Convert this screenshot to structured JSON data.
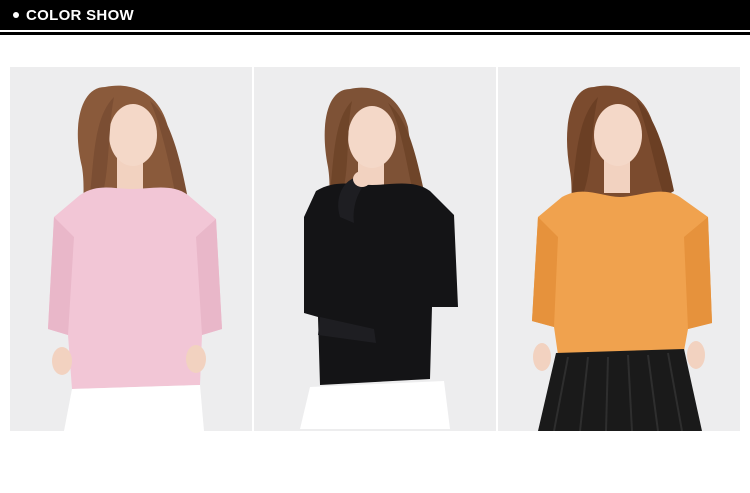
{
  "header": {
    "title": "COLOR SHOW"
  },
  "products": [
    {
      "color_name": "pink",
      "sweater_color": "#f2c6d6"
    },
    {
      "color_name": "black",
      "sweater_color": "#141416"
    },
    {
      "color_name": "orange",
      "sweater_color": "#f0a24e"
    }
  ]
}
